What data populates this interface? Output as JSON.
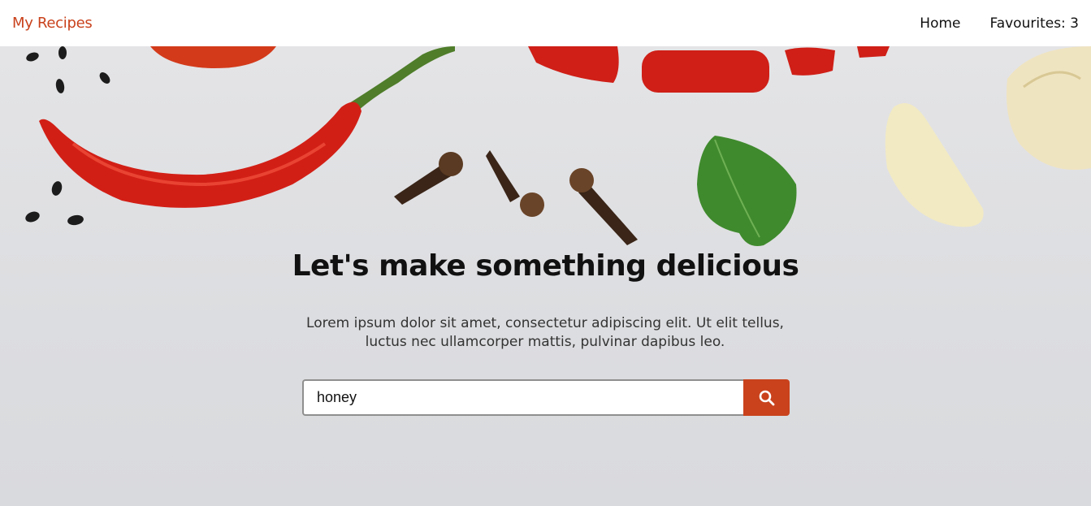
{
  "navbar": {
    "brand": "My Recipes",
    "links": [
      {
        "label": "Home"
      },
      {
        "label": "Favourites: 3"
      }
    ]
  },
  "hero": {
    "title": "Let's make something delicious",
    "text": "Lorem ipsum dolor sit amet, consectetur adipiscing elit. Ut elit tellus, luctus nec ullamcorper mattis, pulvinar dapibus leo."
  },
  "search": {
    "value": "honey",
    "button_icon": "search-icon"
  },
  "colors": {
    "accent": "#c9421c",
    "background": "#e0e1e3"
  }
}
